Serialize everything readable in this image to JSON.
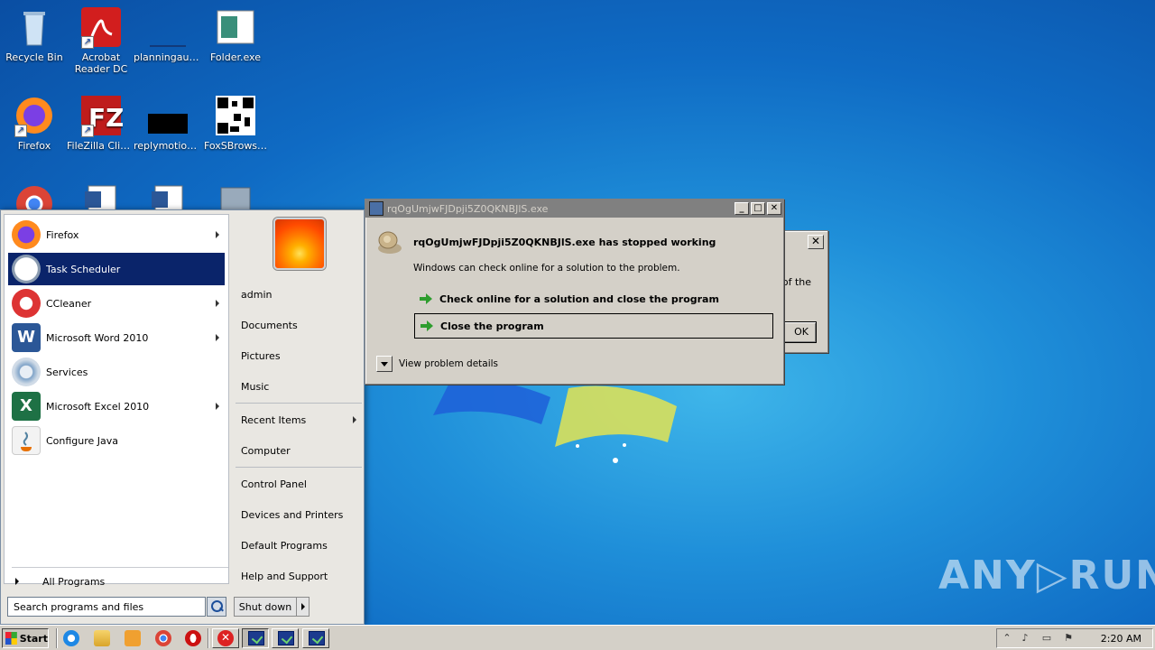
{
  "desktop": {
    "icons": [
      {
        "label": "Recycle Bin"
      },
      {
        "label": "Acrobat Reader DC"
      },
      {
        "label": "planningaut…"
      },
      {
        "label": "Folder.exe"
      },
      {
        "label": "Firefox"
      },
      {
        "label": "FileZilla Client"
      },
      {
        "label": "replymotion…"
      },
      {
        "label": "FoxSBrows…"
      }
    ]
  },
  "start_menu": {
    "programs": [
      {
        "label": "Firefox",
        "submenu": true
      },
      {
        "label": "Task Scheduler",
        "submenu": false,
        "selected": true
      },
      {
        "label": "CCleaner",
        "submenu": true
      },
      {
        "label": "Microsoft Word 2010",
        "submenu": true
      },
      {
        "label": "Services",
        "submenu": false
      },
      {
        "label": "Microsoft Excel 2010",
        "submenu": true
      },
      {
        "label": "Configure Java",
        "submenu": false
      }
    ],
    "all_programs": "All Programs",
    "search_placeholder": "Search programs and files",
    "right": {
      "user": "admin",
      "documents": "Documents",
      "pictures": "Pictures",
      "music": "Music",
      "recent_items": "Recent Items",
      "computer": "Computer",
      "control_panel": "Control Panel",
      "devices_printers": "Devices and Printers",
      "default_programs": "Default Programs",
      "help_support": "Help and Support"
    },
    "shutdown": "Shut down"
  },
  "error_dialog": {
    "title": "rqOgUmjwFJDpji5Z0QKNBJlS.exe",
    "heading": "rqOgUmjwFJDpji5Z0QKNBJlS.exe has stopped working",
    "subtext": "Windows can check online for a solution to the problem.",
    "option_check": "Check online for a solution and close the program",
    "option_close": "Close the program",
    "details": "View problem details",
    "buttons": {
      "minimize": "_",
      "maximize": "□",
      "close": "✕"
    }
  },
  "back_dialog": {
    "text": "of the",
    "ok": "OK",
    "close": "✕"
  },
  "taskbar": {
    "start": "Start",
    "clock": "2:20 AM"
  },
  "watermark": "ANY▷RUN",
  "colors": {
    "accent": "#0a246a",
    "desktop": "#1f8fd9"
  }
}
